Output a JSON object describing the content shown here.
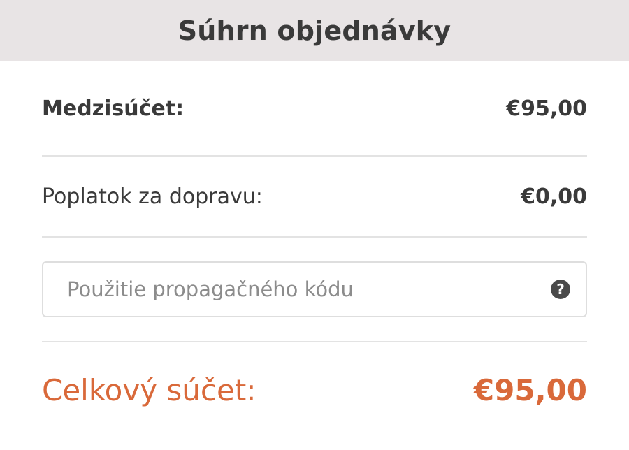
{
  "header": {
    "title": "Súhrn objednávky"
  },
  "summary": {
    "subtotal_label": "Medzisúčet:",
    "subtotal_value": "€95,00",
    "shipping_label": "Poplatok za dopravu:",
    "shipping_value": "€0,00"
  },
  "promo": {
    "placeholder": "Použitie propagačného kódu",
    "value": "",
    "help_icon": "question-circle-icon"
  },
  "total": {
    "label": "Celkový súčet:",
    "value": "€95,00"
  },
  "colors": {
    "header_bg": "#e8e4e5",
    "accent": "#d9693a",
    "text": "#3a3a3a",
    "divider": "#e3e3e3"
  }
}
